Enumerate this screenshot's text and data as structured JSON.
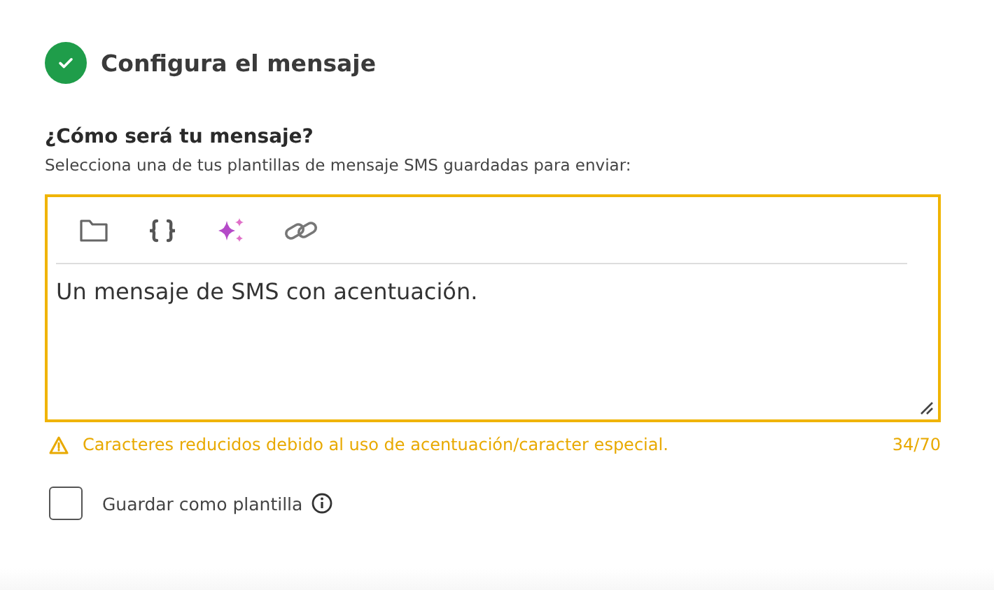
{
  "step": {
    "title": "Configura el mensaje",
    "completed": true
  },
  "question": {
    "title": "¿Cómo será tu mensaje?",
    "subtitle": "Selecciona una de tus plantillas de mensaje SMS guardadas para enviar:"
  },
  "editor": {
    "value": "Un mensaje de SMS con acentuación.",
    "warning": "Caracteres reducidos debido al uso de acentuación/caracter especial.",
    "counter": "34/70"
  },
  "save_template": {
    "label": "Guardar como plantilla",
    "checked": false
  }
}
